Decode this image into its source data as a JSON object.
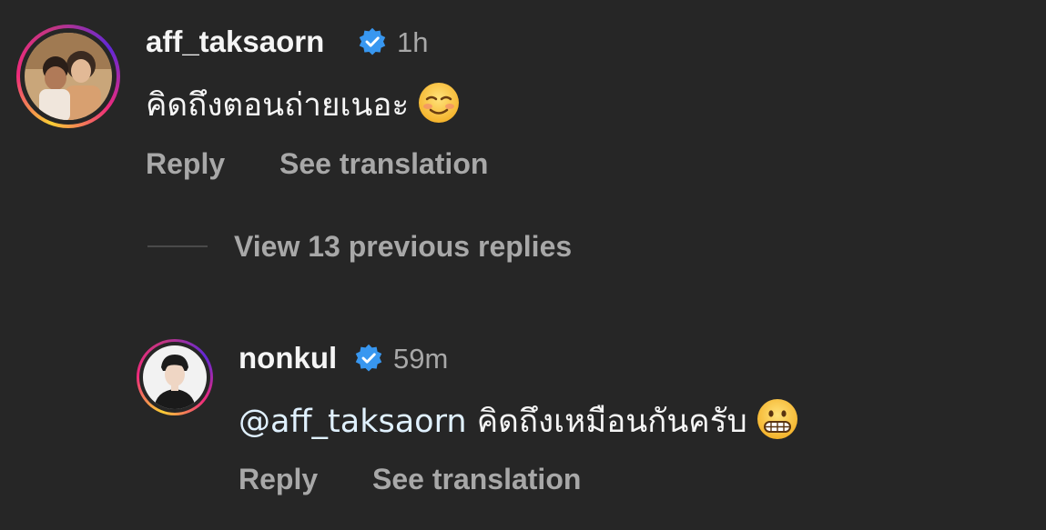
{
  "comments": [
    {
      "username": "aff_taksaorn",
      "verified": true,
      "time": "1h",
      "text": "คิดถึงตอนถ่ายเนอะ",
      "emoji": "smiling-face-icon",
      "reply_label": "Reply",
      "translate_label": "See translation"
    },
    {
      "username": "nonkul",
      "verified": true,
      "time": "59m",
      "mention": "@aff_taksaorn",
      "text": "คิดถึงเหมือนกันครับ",
      "emoji": "grimacing-face-icon",
      "reply_label": "Reply",
      "translate_label": "See translation"
    }
  ],
  "view_replies_label": "View 13 previous replies",
  "colors": {
    "background": "#262626",
    "primary_text": "#f5f5f5",
    "secondary_text": "#a8a8a8",
    "verified_blue": "#3897f0"
  }
}
